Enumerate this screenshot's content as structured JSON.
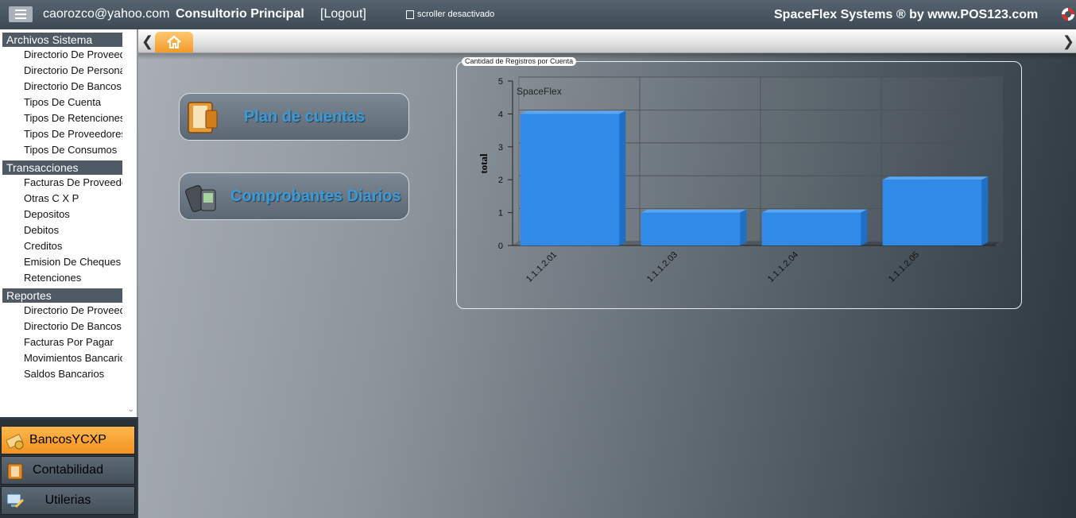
{
  "topbar": {
    "user": "caorozco@yahoo.com",
    "site": "Consultorio Principal",
    "logout": "[Logout]",
    "scroller": "scroller desactivado",
    "brand": "SpaceFlex Systems ® by www.POS123.com"
  },
  "sidebar": {
    "sections": [
      {
        "title": "Archivos Sistema",
        "items": [
          "Directorio De Proveedores",
          "Directorio De Personal",
          "Directorio De Bancos",
          "Tipos De Cuenta",
          "Tipos De Retenciones",
          "Tipos De Proveedores",
          "Tipos De Consumos"
        ]
      },
      {
        "title": "Transacciones",
        "items": [
          "Facturas De Proveedores",
          "Otras C X P",
          "Depositos",
          "Debitos",
          "Creditos",
          "Emision De Cheques",
          "Retenciones"
        ]
      },
      {
        "title": "Reportes",
        "items": [
          "Directorio De Proveedores",
          "Directorio De Bancos",
          "Facturas Por Pagar",
          "Movimientos Bancarios",
          "Saldos Bancarios"
        ]
      }
    ]
  },
  "nav": [
    "BancosYCXP",
    "Contabilidad",
    "Utilerias"
  ],
  "buttons": {
    "plan": "Plan de cuentas",
    "comprobantes": "Comprobantes Diarios"
  },
  "colors": {
    "accent": "#f39a28",
    "bar": "#2f8ae8",
    "button_text": "#3c9ad6"
  },
  "chart_panel_title": "Cantidad de Registros por Cuenta",
  "chart_data": {
    "type": "bar",
    "title": "",
    "watermark": "SpaceFlex",
    "ylabel": "total",
    "xlabel": "",
    "categories": [
      "1.1.1.2.01",
      "1.1.1.2.03",
      "1.1.1.2.04",
      "1.1.1.2.05"
    ],
    "values": [
      4,
      1,
      1,
      2
    ],
    "ylim": [
      0,
      5
    ],
    "yticks": [
      0,
      1,
      2,
      3,
      4,
      5
    ],
    "grid": true,
    "legend": "none"
  }
}
